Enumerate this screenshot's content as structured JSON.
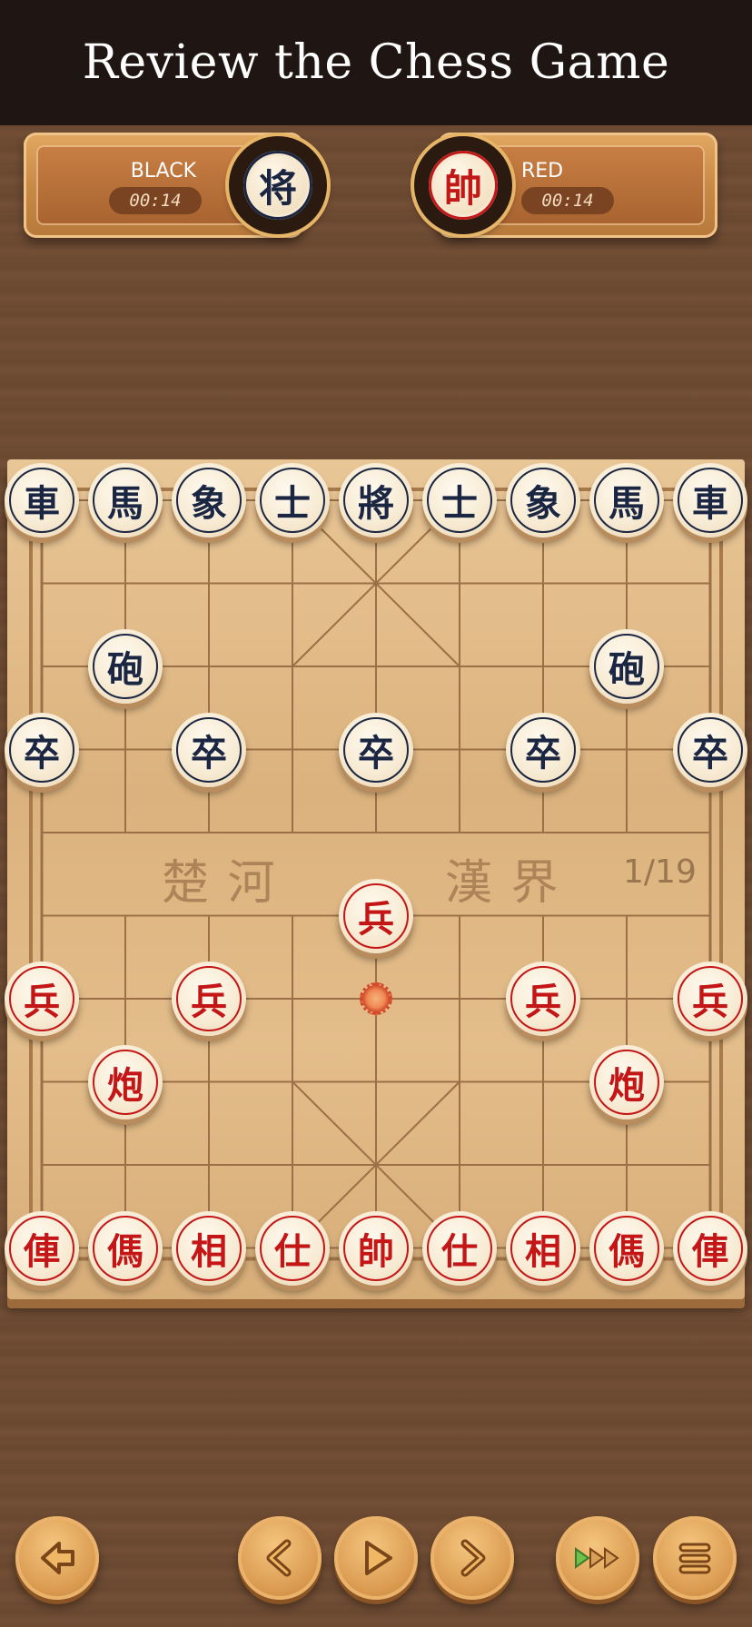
{
  "header": {
    "title": "Review the Chess Game"
  },
  "players": {
    "black": {
      "label": "BLACK",
      "time": "00:14",
      "piece": "将"
    },
    "red": {
      "label": "RED",
      "time": "00:14",
      "piece": "帥"
    }
  },
  "board": {
    "river_left": "楚 河",
    "river_right": "漢 界",
    "move_counter": "1/19",
    "pieces": [
      {
        "side": "black",
        "char": "車",
        "file": 0,
        "rank": 0
      },
      {
        "side": "black",
        "char": "馬",
        "file": 1,
        "rank": 0
      },
      {
        "side": "black",
        "char": "象",
        "file": 2,
        "rank": 0
      },
      {
        "side": "black",
        "char": "士",
        "file": 3,
        "rank": 0
      },
      {
        "side": "black",
        "char": "將",
        "file": 4,
        "rank": 0
      },
      {
        "side": "black",
        "char": "士",
        "file": 5,
        "rank": 0
      },
      {
        "side": "black",
        "char": "象",
        "file": 6,
        "rank": 0
      },
      {
        "side": "black",
        "char": "馬",
        "file": 7,
        "rank": 0
      },
      {
        "side": "black",
        "char": "車",
        "file": 8,
        "rank": 0
      },
      {
        "side": "black",
        "char": "砲",
        "file": 1,
        "rank": 2
      },
      {
        "side": "black",
        "char": "砲",
        "file": 7,
        "rank": 2
      },
      {
        "side": "black",
        "char": "卒",
        "file": 0,
        "rank": 3
      },
      {
        "side": "black",
        "char": "卒",
        "file": 2,
        "rank": 3
      },
      {
        "side": "black",
        "char": "卒",
        "file": 4,
        "rank": 3
      },
      {
        "side": "black",
        "char": "卒",
        "file": 6,
        "rank": 3
      },
      {
        "side": "black",
        "char": "卒",
        "file": 8,
        "rank": 3
      },
      {
        "side": "red",
        "char": "兵",
        "file": 4,
        "rank": 5
      },
      {
        "side": "red",
        "char": "兵",
        "file": 0,
        "rank": 6
      },
      {
        "side": "red",
        "char": "兵",
        "file": 2,
        "rank": 6
      },
      {
        "side": "red",
        "char": "兵",
        "file": 6,
        "rank": 6
      },
      {
        "side": "red",
        "char": "兵",
        "file": 8,
        "rank": 6
      },
      {
        "side": "red",
        "char": "炮",
        "file": 1,
        "rank": 7
      },
      {
        "side": "red",
        "char": "炮",
        "file": 7,
        "rank": 7
      },
      {
        "side": "red",
        "char": "俥",
        "file": 0,
        "rank": 9
      },
      {
        "side": "red",
        "char": "傌",
        "file": 1,
        "rank": 9
      },
      {
        "side": "red",
        "char": "相",
        "file": 2,
        "rank": 9
      },
      {
        "side": "red",
        "char": "仕",
        "file": 3,
        "rank": 9
      },
      {
        "side": "red",
        "char": "帥",
        "file": 4,
        "rank": 9
      },
      {
        "side": "red",
        "char": "仕",
        "file": 5,
        "rank": 9
      },
      {
        "side": "red",
        "char": "相",
        "file": 6,
        "rank": 9
      },
      {
        "side": "red",
        "char": "傌",
        "file": 7,
        "rank": 9
      },
      {
        "side": "red",
        "char": "俥",
        "file": 8,
        "rank": 9
      }
    ],
    "last_move_from": {
      "file": 4,
      "rank": 6
    }
  },
  "controls": [
    {
      "name": "back-button",
      "icon": "arrow-left-icon"
    },
    {
      "name": "previous-move-button",
      "icon": "chevron-left-icon"
    },
    {
      "name": "play-button",
      "icon": "play-icon"
    },
    {
      "name": "next-move-button",
      "icon": "chevron-right-icon"
    },
    {
      "name": "fast-forward-button",
      "icon": "fast-forward-icon"
    },
    {
      "name": "menu-button",
      "icon": "menu-icon"
    }
  ],
  "colors": {
    "red_piece": "#c41616",
    "black_piece": "#1b2742",
    "accent_green": "#6cc24a"
  }
}
